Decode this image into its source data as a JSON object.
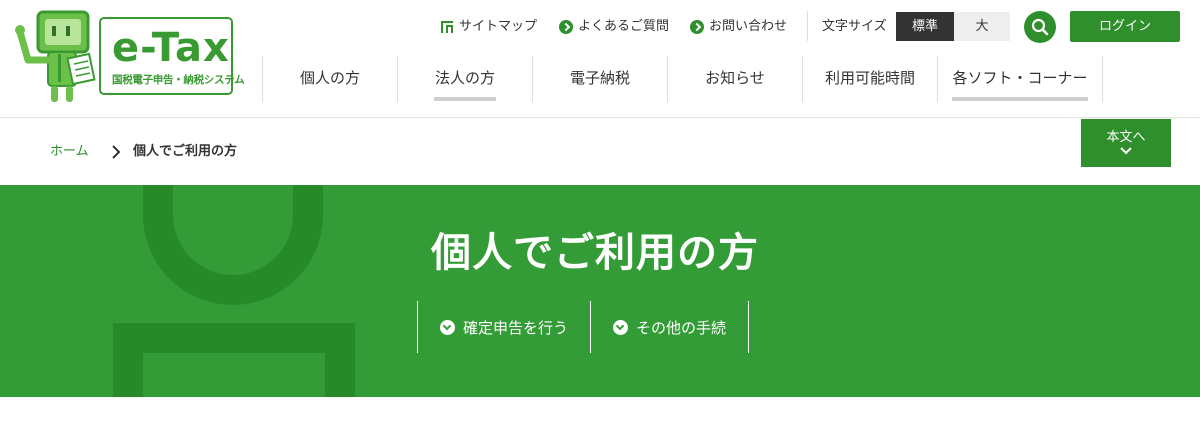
{
  "logo": {
    "text": "e-Tax",
    "subtitle": "国税電子申告・納税システム"
  },
  "utility": {
    "sitemap": "サイトマップ",
    "faq": "よくあるご質問",
    "contact": "お問い合わせ",
    "font_size_label": "文字サイズ",
    "font_standard": "標準",
    "font_large": "大",
    "login": "ログイン"
  },
  "global_nav": [
    {
      "label": "個人の方"
    },
    {
      "label": "法人の方"
    },
    {
      "label": "電子納税"
    },
    {
      "label": "お知らせ"
    },
    {
      "label": "利用可能時間"
    },
    {
      "label": "各ソフト・コーナー"
    }
  ],
  "breadcrumb": {
    "home": "ホーム",
    "current": "個人でご利用の方"
  },
  "skip_link": "本文へ",
  "hero": {
    "title": "個人でご利用の方",
    "links": [
      {
        "label": "確定申告を行う"
      },
      {
        "label": "その他の手続"
      }
    ]
  },
  "colors": {
    "brand_green": "#2f8f2d",
    "hero_green": "#349c36",
    "deco_green": "#268a29"
  }
}
